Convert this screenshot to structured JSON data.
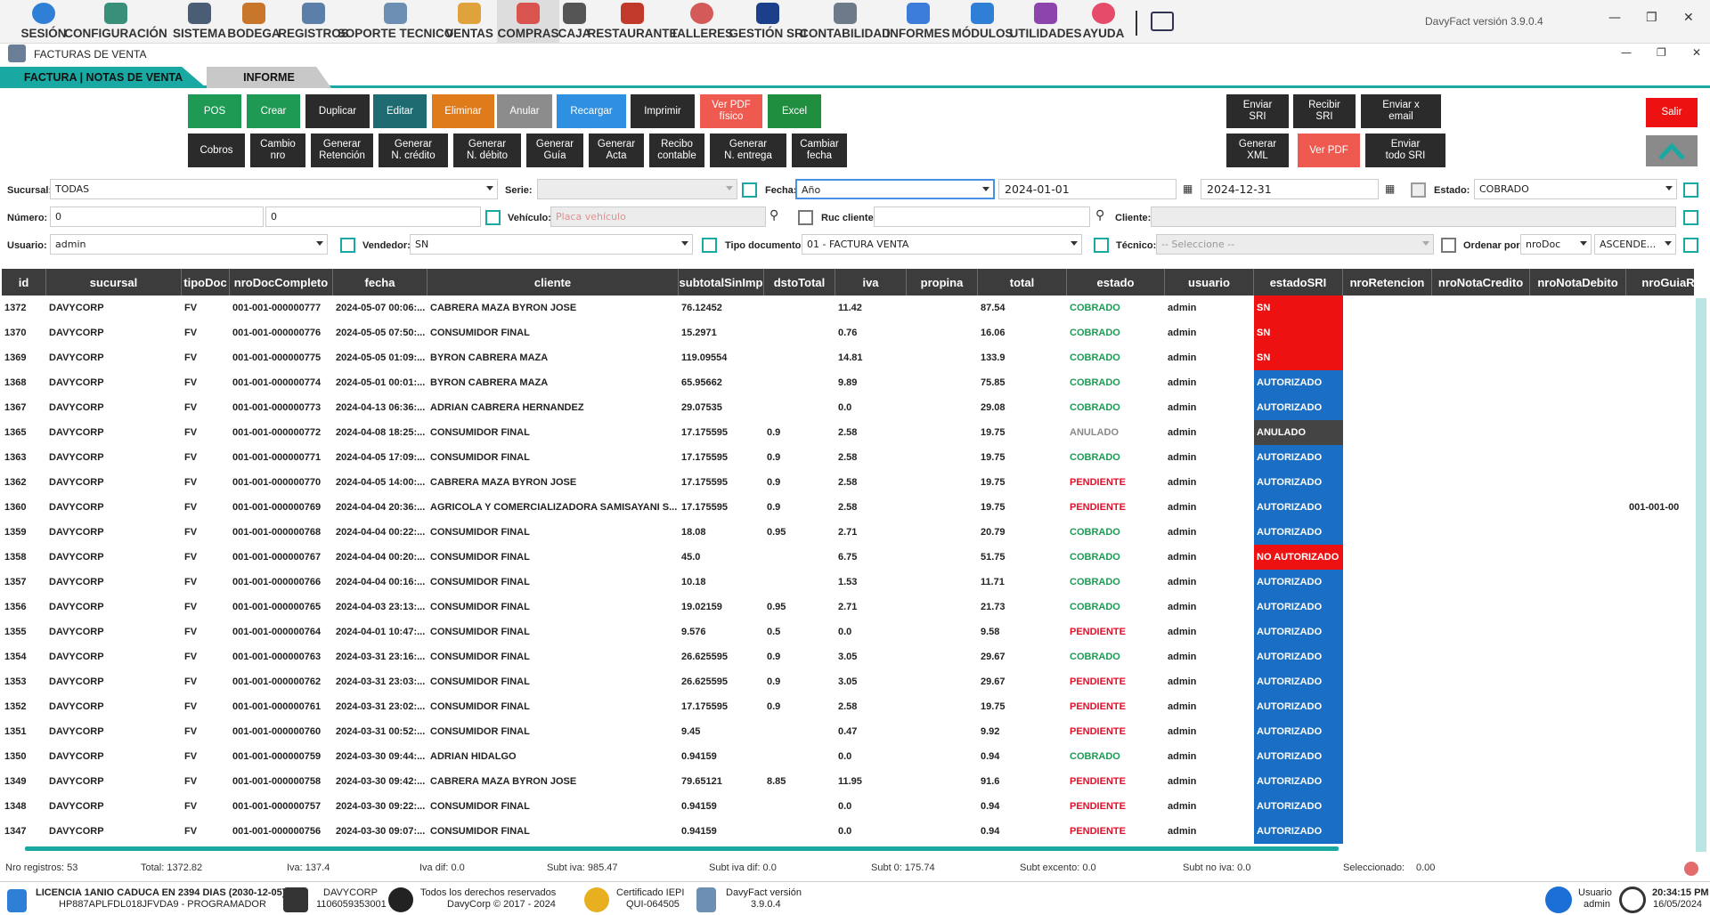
{
  "menu": [
    {
      "label": "SESIÓN",
      "icon": "session-icon",
      "color": "#2f7fd6"
    },
    {
      "label": "CONFIGURACIÓN",
      "icon": "gears-icon",
      "color": "#3a8f7a"
    },
    {
      "label": "SISTEMA",
      "icon": "monitor-icon",
      "color": "#4a5d74"
    },
    {
      "label": "BODEGA",
      "icon": "warehouse-icon",
      "color": "#c7762a"
    },
    {
      "label": "REGISTROS",
      "icon": "registry-icon",
      "color": "#5b7fa8"
    },
    {
      "label": "SOPORTE TECNICO",
      "icon": "support-icon",
      "color": "#6c8fb3"
    },
    {
      "label": "VENTAS",
      "icon": "sales-icon",
      "color": "#e0a23a"
    },
    {
      "label": "COMPRAS",
      "icon": "cart-icon",
      "color": "#d9534f"
    },
    {
      "label": "CAJA",
      "icon": "cash-register-icon",
      "color": "#555555"
    },
    {
      "label": "RESTAURANTE",
      "icon": "restaurant-icon",
      "color": "#c0392b"
    },
    {
      "label": "TALLERES",
      "icon": "workshop-icon",
      "color": "#d45a5a"
    },
    {
      "label": "GESTIÓN SRI",
      "icon": "sri-icon",
      "color": "#1b3f8a"
    },
    {
      "label": "CONTABILIDAD",
      "icon": "accounting-icon",
      "color": "#6c7a89"
    },
    {
      "label": "INFORMES",
      "icon": "chart-icon",
      "color": "#3b7dd8"
    },
    {
      "label": "MÓDULOS",
      "icon": "modules-icon",
      "color": "#2f7fd6"
    },
    {
      "label": "UTILIDADES",
      "icon": "utilities-icon",
      "color": "#8e44ad"
    },
    {
      "label": "AYUDA",
      "icon": "help-icon",
      "color": "#e64c6a"
    }
  ],
  "app_version": "DavyFact versión 3.9.0.4",
  "form_title": "FACTURAS DE VENTA",
  "tabs": {
    "tab1": "FACTURA | NOTAS DE VENTA",
    "tab2": "INFORME"
  },
  "buttons": {
    "pos": "POS",
    "crear": "Crear",
    "duplicar": "Duplicar",
    "editar": "Editar",
    "eliminar": "Eliminar",
    "anular": "Anular",
    "recargar": "Recargar",
    "imprimir": "Imprimir",
    "ver_pdf_fisico": "Ver PDF\nfísico",
    "excel": "Excel",
    "cobros": "Cobros",
    "cambio_nro": "Cambio\nnro",
    "generar_retencion": "Generar\nRetención",
    "generar_ncredito": "Generar\nN. crédito",
    "generar_ndebito": "Generar\nN. débito",
    "generar_guia": "Generar\nGuía",
    "generar_acta": "Generar\nActa",
    "recibo_contable": "Recibo\ncontable",
    "generar_nentrega": "Generar\nN. entrega",
    "cambiar_fecha": "Cambiar\nfecha",
    "enviar_sri": "Enviar\nSRI",
    "recibir_sri": "Recibir\nSRI",
    "enviar_email": "Enviar x\nemail",
    "generar_xml": "Generar\nXML",
    "ver_pdf": "Ver PDF",
    "enviar_todo_sri": "Enviar\ntodo SRI",
    "salir": "Salir"
  },
  "colors": {
    "green": "#1e9a55",
    "teal": "#1f6b72",
    "orange": "#e07b1c",
    "grey": "#8c8c8c",
    "blue": "#2f8fe0",
    "dark": "#2b2b2b",
    "salmon": "#ef5a50",
    "excel": "#1f8f3f",
    "red": "#ee1111",
    "accent": "#1aa9a2",
    "sri_blue": "#1a6fc4",
    "sri_red": "#ee1111",
    "sri_dark": "#444444",
    "cobrado": "#1e9a55",
    "pendiente": "#e0102a",
    "anulado": "#888888"
  },
  "filters": {
    "sucursal_label": "Sucursal:",
    "sucursal_value": "TODAS",
    "serie_label": "Serie:",
    "fecha_label": "Fecha:",
    "fecha_value": "Año",
    "fecha_desde": "2024-01-01",
    "fecha_hasta": "2024-12-31",
    "estado_label": "Estado:",
    "estado_value": "COBRADO",
    "numero_label": "Número:",
    "numero_desde": "0",
    "numero_hasta": "0",
    "vehiculo_label": "Vehículo:",
    "vehiculo_placeholder": "Placa vehículo",
    "ruc_label": "Ruc cliente:",
    "cliente_label": "Cliente:",
    "usuario_label": "Usuario:",
    "usuario_value": "admin",
    "vendedor_label": "Vendedor:",
    "vendedor_value": "SN",
    "tipodoc_label": "Tipo documento:",
    "tipodoc_value": "01 - FACTURA VENTA",
    "tecnico_label": "Técnico:",
    "tecnico_value": "-- Seleccione --",
    "ordenar_label": "Ordenar por:",
    "ordenar_value": "nroDoc",
    "orden_value": "ASCENDE..."
  },
  "table": {
    "columns": [
      "id",
      "sucursal",
      "tipoDoc",
      "nroDocCompleto",
      "fecha",
      "cliente",
      "subtotalSinImp",
      "dstoTotal",
      "iva",
      "propina",
      "total",
      "estado",
      "usuario",
      "estadoSRI",
      "nroRetencion",
      "nroNotaCredito",
      "nroNotaDebito",
      "nroGuiaR"
    ],
    "rows": [
      [
        "1372",
        "DAVYCORP",
        "FV",
        "001-001-000000777",
        "2024-05-07 00:06:...",
        "CABRERA MAZA BYRON JOSE",
        "76.12452",
        "",
        "11.42",
        "",
        "87.54",
        "COBRADO",
        "admin",
        "SN",
        "",
        "",
        "",
        ""
      ],
      [
        "1370",
        "DAVYCORP",
        "FV",
        "001-001-000000776",
        "2024-05-05 07:50:...",
        "CONSUMIDOR FINAL",
        "15.2971",
        "",
        "0.76",
        "",
        "16.06",
        "COBRADO",
        "admin",
        "SN",
        "",
        "",
        "",
        ""
      ],
      [
        "1369",
        "DAVYCORP",
        "FV",
        "001-001-000000775",
        "2024-05-05 01:09:...",
        "BYRON CABRERA MAZA",
        "119.09554",
        "",
        "14.81",
        "",
        "133.9",
        "COBRADO",
        "admin",
        "SN",
        "",
        "",
        "",
        ""
      ],
      [
        "1368",
        "DAVYCORP",
        "FV",
        "001-001-000000774",
        "2024-05-01 00:01:...",
        "BYRON CABRERA MAZA",
        "65.95662",
        "",
        "9.89",
        "",
        "75.85",
        "COBRADO",
        "admin",
        "AUTORIZADO",
        "",
        "",
        "",
        ""
      ],
      [
        "1367",
        "DAVYCORP",
        "FV",
        "001-001-000000773",
        "2024-04-13 06:36:...",
        "ADRIAN CABRERA HERNANDEZ",
        "29.07535",
        "",
        "0.0",
        "",
        "29.08",
        "COBRADO",
        "admin",
        "AUTORIZADO",
        "",
        "",
        "",
        ""
      ],
      [
        "1365",
        "DAVYCORP",
        "FV",
        "001-001-000000772",
        "2024-04-08 18:25:...",
        "CONSUMIDOR FINAL",
        "17.175595",
        "0.9",
        "2.58",
        "",
        "19.75",
        "ANULADO",
        "admin",
        "ANULADO",
        "",
        "",
        "",
        ""
      ],
      [
        "1363",
        "DAVYCORP",
        "FV",
        "001-001-000000771",
        "2024-04-05 17:09:...",
        "CONSUMIDOR FINAL",
        "17.175595",
        "0.9",
        "2.58",
        "",
        "19.75",
        "COBRADO",
        "admin",
        "AUTORIZADO",
        "",
        "",
        "",
        ""
      ],
      [
        "1362",
        "DAVYCORP",
        "FV",
        "001-001-000000770",
        "2024-04-05 14:00:...",
        "CABRERA MAZA BYRON JOSE",
        "17.175595",
        "0.9",
        "2.58",
        "",
        "19.75",
        "PENDIENTE",
        "admin",
        "AUTORIZADO",
        "",
        "",
        "",
        ""
      ],
      [
        "1360",
        "DAVYCORP",
        "FV",
        "001-001-000000769",
        "2024-04-04 20:36:...",
        "AGRICOLA Y COMERCIALIZADORA SAMISAYANI S...",
        "17.175595",
        "0.9",
        "2.58",
        "",
        "19.75",
        "PENDIENTE",
        "admin",
        "AUTORIZADO",
        "",
        "",
        "",
        "001-001-00"
      ],
      [
        "1359",
        "DAVYCORP",
        "FV",
        "001-001-000000768",
        "2024-04-04 00:22:...",
        "CONSUMIDOR FINAL",
        "18.08",
        "0.95",
        "2.71",
        "",
        "20.79",
        "COBRADO",
        "admin",
        "AUTORIZADO",
        "",
        "",
        "",
        ""
      ],
      [
        "1358",
        "DAVYCORP",
        "FV",
        "001-001-000000767",
        "2024-04-04 00:20:...",
        "CONSUMIDOR FINAL",
        "45.0",
        "",
        "6.75",
        "",
        "51.75",
        "COBRADO",
        "admin",
        "NO AUTORIZADO",
        "",
        "",
        "",
        ""
      ],
      [
        "1357",
        "DAVYCORP",
        "FV",
        "001-001-000000766",
        "2024-04-04 00:16:...",
        "CONSUMIDOR FINAL",
        "10.18",
        "",
        "1.53",
        "",
        "11.71",
        "COBRADO",
        "admin",
        "AUTORIZADO",
        "",
        "",
        "",
        ""
      ],
      [
        "1356",
        "DAVYCORP",
        "FV",
        "001-001-000000765",
        "2024-04-03 23:13:...",
        "CONSUMIDOR FINAL",
        "19.02159",
        "0.95",
        "2.71",
        "",
        "21.73",
        "COBRADO",
        "admin",
        "AUTORIZADO",
        "",
        "",
        "",
        ""
      ],
      [
        "1355",
        "DAVYCORP",
        "FV",
        "001-001-000000764",
        "2024-04-01 10:47:...",
        "CONSUMIDOR FINAL",
        "9.576",
        "0.5",
        "0.0",
        "",
        "9.58",
        "PENDIENTE",
        "admin",
        "AUTORIZADO",
        "",
        "",
        "",
        ""
      ],
      [
        "1354",
        "DAVYCORP",
        "FV",
        "001-001-000000763",
        "2024-03-31 23:16:...",
        "CONSUMIDOR FINAL",
        "26.625595",
        "0.9",
        "3.05",
        "",
        "29.67",
        "COBRADO",
        "admin",
        "AUTORIZADO",
        "",
        "",
        "",
        ""
      ],
      [
        "1353",
        "DAVYCORP",
        "FV",
        "001-001-000000762",
        "2024-03-31 23:03:...",
        "CONSUMIDOR FINAL",
        "26.625595",
        "0.9",
        "3.05",
        "",
        "29.67",
        "PENDIENTE",
        "admin",
        "AUTORIZADO",
        "",
        "",
        "",
        ""
      ],
      [
        "1352",
        "DAVYCORP",
        "FV",
        "001-001-000000761",
        "2024-03-31 23:02:...",
        "CONSUMIDOR FINAL",
        "17.175595",
        "0.9",
        "2.58",
        "",
        "19.75",
        "PENDIENTE",
        "admin",
        "AUTORIZADO",
        "",
        "",
        "",
        ""
      ],
      [
        "1351",
        "DAVYCORP",
        "FV",
        "001-001-000000760",
        "2024-03-31 00:52:...",
        "CONSUMIDOR FINAL",
        "9.45",
        "",
        "0.47",
        "",
        "9.92",
        "PENDIENTE",
        "admin",
        "AUTORIZADO",
        "",
        "",
        "",
        ""
      ],
      [
        "1350",
        "DAVYCORP",
        "FV",
        "001-001-000000759",
        "2024-03-30 09:44:...",
        "ADRIAN HIDALGO",
        "0.94159",
        "",
        "0.0",
        "",
        "0.94",
        "COBRADO",
        "admin",
        "AUTORIZADO",
        "",
        "",
        "",
        ""
      ],
      [
        "1349",
        "DAVYCORP",
        "FV",
        "001-001-000000758",
        "2024-03-30 09:42:...",
        "CABRERA MAZA BYRON JOSE",
        "79.65121",
        "8.85",
        "11.95",
        "",
        "91.6",
        "PENDIENTE",
        "admin",
        "AUTORIZADO",
        "",
        "",
        "",
        ""
      ],
      [
        "1348",
        "DAVYCORP",
        "FV",
        "001-001-000000757",
        "2024-03-30 09:22:...",
        "CONSUMIDOR FINAL",
        "0.94159",
        "",
        "0.0",
        "",
        "0.94",
        "PENDIENTE",
        "admin",
        "AUTORIZADO",
        "",
        "",
        "",
        ""
      ],
      [
        "1347",
        "DAVYCORP",
        "FV",
        "001-001-000000756",
        "2024-03-30 09:07:...",
        "CONSUMIDOR FINAL",
        "0.94159",
        "",
        "0.0",
        "",
        "0.94",
        "PENDIENTE",
        "admin",
        "AUTORIZADO",
        "",
        "",
        "",
        ""
      ]
    ]
  },
  "summary": {
    "nro_registros": "Nro registros: 53",
    "total": "Total: 1372.82",
    "iva": "Iva: 137.4",
    "iva_dif": "Iva dif: 0.0",
    "subt_iva": "Subt iva: 985.47",
    "subt_iva_dif": "Subt iva dif: 0.0",
    "subt_0": "Subt 0: 175.74",
    "subt_excento": "Subt excento: 0.0",
    "subt_no_iva": "Subt no iva: 0.0",
    "seleccionado_label": "Seleccionado:",
    "seleccionado_value": "0.00"
  },
  "statusbar": {
    "license_line1": "LICENCIA 1ANIO CADUCA EN 2394 DIAS (2030-12-05)",
    "license_line2": "HP887APLFDL018JFVDA9 - PROGRAMADOR",
    "company_name": "DAVYCORP",
    "company_ruc": "1106059353001",
    "rights_line1": "Todos los derechos reservados",
    "rights_line2": "DavyCorp © 2017 - 2024",
    "cert_line1": "Certificado IEPI",
    "cert_line2": "QUI-064505",
    "version_line1": "DavyFact versión",
    "version_line2": "3.9.0.4",
    "user_label": "Usuario",
    "user_value": "admin",
    "time": "20:34:15 PM",
    "date": "16/05/2024"
  }
}
